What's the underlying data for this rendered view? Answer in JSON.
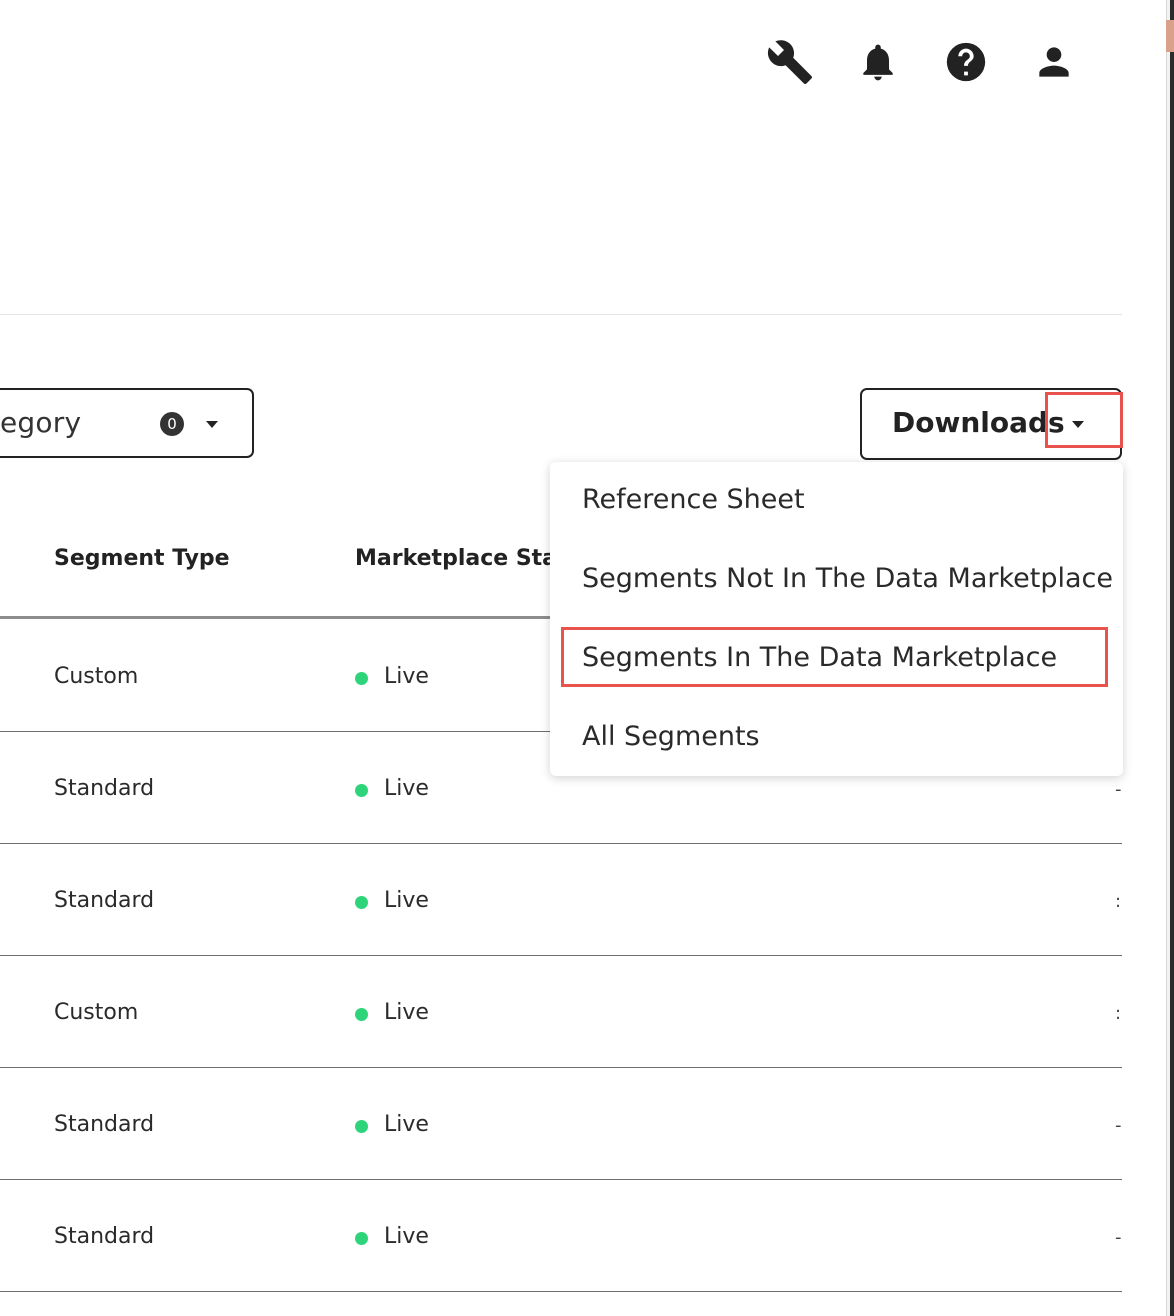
{
  "header": {
    "icons": [
      "wrench-icon",
      "bell-icon",
      "help-icon",
      "user-icon"
    ]
  },
  "filters": {
    "category_label_partial": "egory",
    "category_badge": "0"
  },
  "downloads": {
    "label": "Downloads",
    "menu": [
      "Reference Sheet",
      "Segments Not In The Data Marketplace",
      "Segments In The Data Marketplace",
      "All Segments"
    ],
    "highlight_color": "#e8534d"
  },
  "table": {
    "headers": {
      "segment_type": "Segment Type",
      "marketplace_status_partial": "Marketplace Stat"
    },
    "rows": [
      {
        "segment_type": "Custom",
        "status": "Live"
      },
      {
        "segment_type": "Standard",
        "status": "Live"
      },
      {
        "segment_type": "Standard",
        "status": "Live"
      },
      {
        "segment_type": "Custom",
        "status": "Live"
      },
      {
        "segment_type": "Standard",
        "status": "Live"
      },
      {
        "segment_type": "Standard",
        "status": "Live"
      }
    ],
    "status_color": "#2ed47a"
  }
}
